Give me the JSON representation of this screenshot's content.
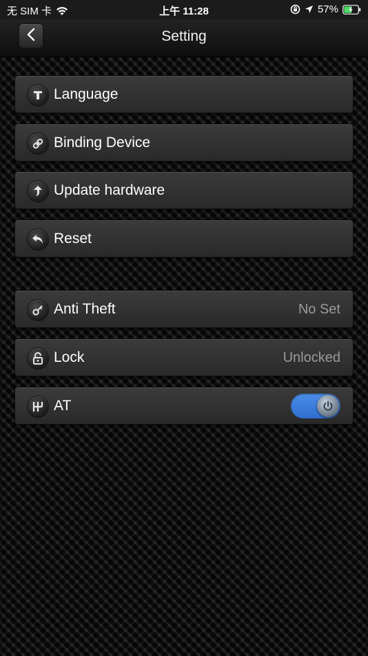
{
  "status_bar": {
    "carrier": "无 SIM 卡",
    "time": "上午 11:28",
    "battery_percent": "57%",
    "battery_level": 0.57
  },
  "nav": {
    "title": "Setting",
    "back_icon": "chevron-left-icon"
  },
  "rows": [
    {
      "label": "Language",
      "icon": "text-t-icon"
    },
    {
      "label": "Binding Device",
      "icon": "link-icon"
    },
    {
      "label": "Update hardware",
      "icon": "up-arrow-icon"
    },
    {
      "label": "Reset",
      "icon": "undo-icon"
    },
    {
      "label": "Anti Theft",
      "value": "No Set",
      "icon": "key-icon"
    },
    {
      "label": "Lock",
      "value": "Unlocked",
      "icon": "unlock-icon"
    },
    {
      "label": "AT",
      "icon": "gear-shift-icon",
      "toggle_on": true
    }
  ],
  "colors": {
    "toggle_on": "#3a7ddc",
    "value_text": "#9a9a9a"
  }
}
